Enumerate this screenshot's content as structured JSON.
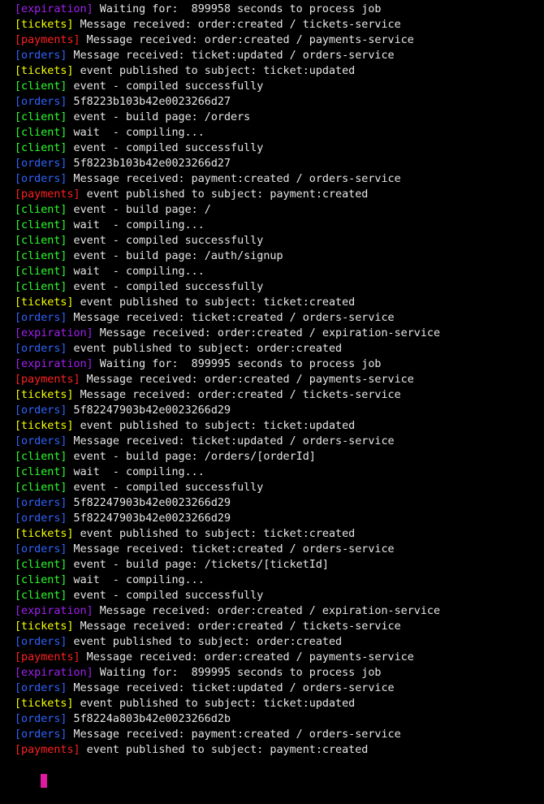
{
  "terminal": {
    "colors": {
      "expiration": "#a020f0",
      "tickets": "#f5ff00",
      "payments": "#ff2020",
      "orders": "#2f64ff",
      "client": "#2cff2c",
      "text": "#e6e6e6",
      "background": "#000000",
      "cursor": "#e01aa0"
    },
    "lines": [
      {
        "service": "expiration",
        "tag": "[expiration]",
        "text": " Waiting for:  899958 seconds to process job"
      },
      {
        "service": "tickets",
        "tag": "[tickets]",
        "text": " Message received: order:created / tickets-service"
      },
      {
        "service": "payments",
        "tag": "[payments]",
        "text": " Message received: order:created / payments-service"
      },
      {
        "service": "orders",
        "tag": "[orders]",
        "text": " Message received: ticket:updated / orders-service"
      },
      {
        "service": "tickets",
        "tag": "[tickets]",
        "text": " event published to subject: ticket:updated"
      },
      {
        "service": "client",
        "tag": "[client]",
        "text": " event - compiled successfully"
      },
      {
        "service": "orders",
        "tag": "[orders]",
        "text": " 5f8223b103b42e0023266d27"
      },
      {
        "service": "client",
        "tag": "[client]",
        "text": " event - build page: /orders"
      },
      {
        "service": "client",
        "tag": "[client]",
        "text": " wait  - compiling..."
      },
      {
        "service": "client",
        "tag": "[client]",
        "text": " event - compiled successfully"
      },
      {
        "service": "orders",
        "tag": "[orders]",
        "text": " 5f8223b103b42e0023266d27"
      },
      {
        "service": "orders",
        "tag": "[orders]",
        "text": " Message received: payment:created / orders-service"
      },
      {
        "service": "payments",
        "tag": "[payments]",
        "text": " event published to subject: payment:created"
      },
      {
        "service": "client",
        "tag": "[client]",
        "text": " event - build page: /"
      },
      {
        "service": "client",
        "tag": "[client]",
        "text": " wait  - compiling..."
      },
      {
        "service": "client",
        "tag": "[client]",
        "text": " event - compiled successfully"
      },
      {
        "service": "client",
        "tag": "[client]",
        "text": " event - build page: /auth/signup"
      },
      {
        "service": "client",
        "tag": "[client]",
        "text": " wait  - compiling..."
      },
      {
        "service": "client",
        "tag": "[client]",
        "text": " event - compiled successfully"
      },
      {
        "service": "tickets",
        "tag": "[tickets]",
        "text": " event published to subject: ticket:created"
      },
      {
        "service": "orders",
        "tag": "[orders]",
        "text": " Message received: ticket:created / orders-service"
      },
      {
        "service": "expiration",
        "tag": "[expiration]",
        "text": " Message received: order:created / expiration-service"
      },
      {
        "service": "orders",
        "tag": "[orders]",
        "text": " event published to subject: order:created"
      },
      {
        "service": "expiration",
        "tag": "[expiration]",
        "text": " Waiting for:  899995 seconds to process job"
      },
      {
        "service": "payments",
        "tag": "[payments]",
        "text": " Message received: order:created / payments-service"
      },
      {
        "service": "tickets",
        "tag": "[tickets]",
        "text": " Message received: order:created / tickets-service"
      },
      {
        "service": "orders",
        "tag": "[orders]",
        "text": " 5f82247903b42e0023266d29"
      },
      {
        "service": "tickets",
        "tag": "[tickets]",
        "text": " event published to subject: ticket:updated"
      },
      {
        "service": "orders",
        "tag": "[orders]",
        "text": " Message received: ticket:updated / orders-service"
      },
      {
        "service": "client",
        "tag": "[client]",
        "text": " event - build page: /orders/[orderId]"
      },
      {
        "service": "client",
        "tag": "[client]",
        "text": " wait  - compiling..."
      },
      {
        "service": "client",
        "tag": "[client]",
        "text": " event - compiled successfully"
      },
      {
        "service": "orders",
        "tag": "[orders]",
        "text": " 5f82247903b42e0023266d29"
      },
      {
        "service": "orders",
        "tag": "[orders]",
        "text": " 5f82247903b42e0023266d29"
      },
      {
        "service": "tickets",
        "tag": "[tickets]",
        "text": " event published to subject: ticket:created"
      },
      {
        "service": "orders",
        "tag": "[orders]",
        "text": " Message received: ticket:created / orders-service"
      },
      {
        "service": "client",
        "tag": "[client]",
        "text": " event - build page: /tickets/[ticketId]"
      },
      {
        "service": "client",
        "tag": "[client]",
        "text": " wait  - compiling..."
      },
      {
        "service": "client",
        "tag": "[client]",
        "text": " event - compiled successfully"
      },
      {
        "service": "expiration",
        "tag": "[expiration]",
        "text": " Message received: order:created / expiration-service"
      },
      {
        "service": "tickets",
        "tag": "[tickets]",
        "text": " Message received: order:created / tickets-service"
      },
      {
        "service": "orders",
        "tag": "[orders]",
        "text": " event published to subject: order:created"
      },
      {
        "service": "payments",
        "tag": "[payments]",
        "text": " Message received: order:created / payments-service"
      },
      {
        "service": "expiration",
        "tag": "[expiration]",
        "text": " Waiting for:  899995 seconds to process job"
      },
      {
        "service": "orders",
        "tag": "[orders]",
        "text": " Message received: ticket:updated / orders-service"
      },
      {
        "service": "tickets",
        "tag": "[tickets]",
        "text": " event published to subject: ticket:updated"
      },
      {
        "service": "orders",
        "tag": "[orders]",
        "text": " 5f8224a803b42e0023266d2b"
      },
      {
        "service": "orders",
        "tag": "[orders]",
        "text": " Message received: payment:created / orders-service"
      },
      {
        "service": "payments",
        "tag": "[payments]",
        "text": " event published to subject: payment:created"
      }
    ]
  }
}
